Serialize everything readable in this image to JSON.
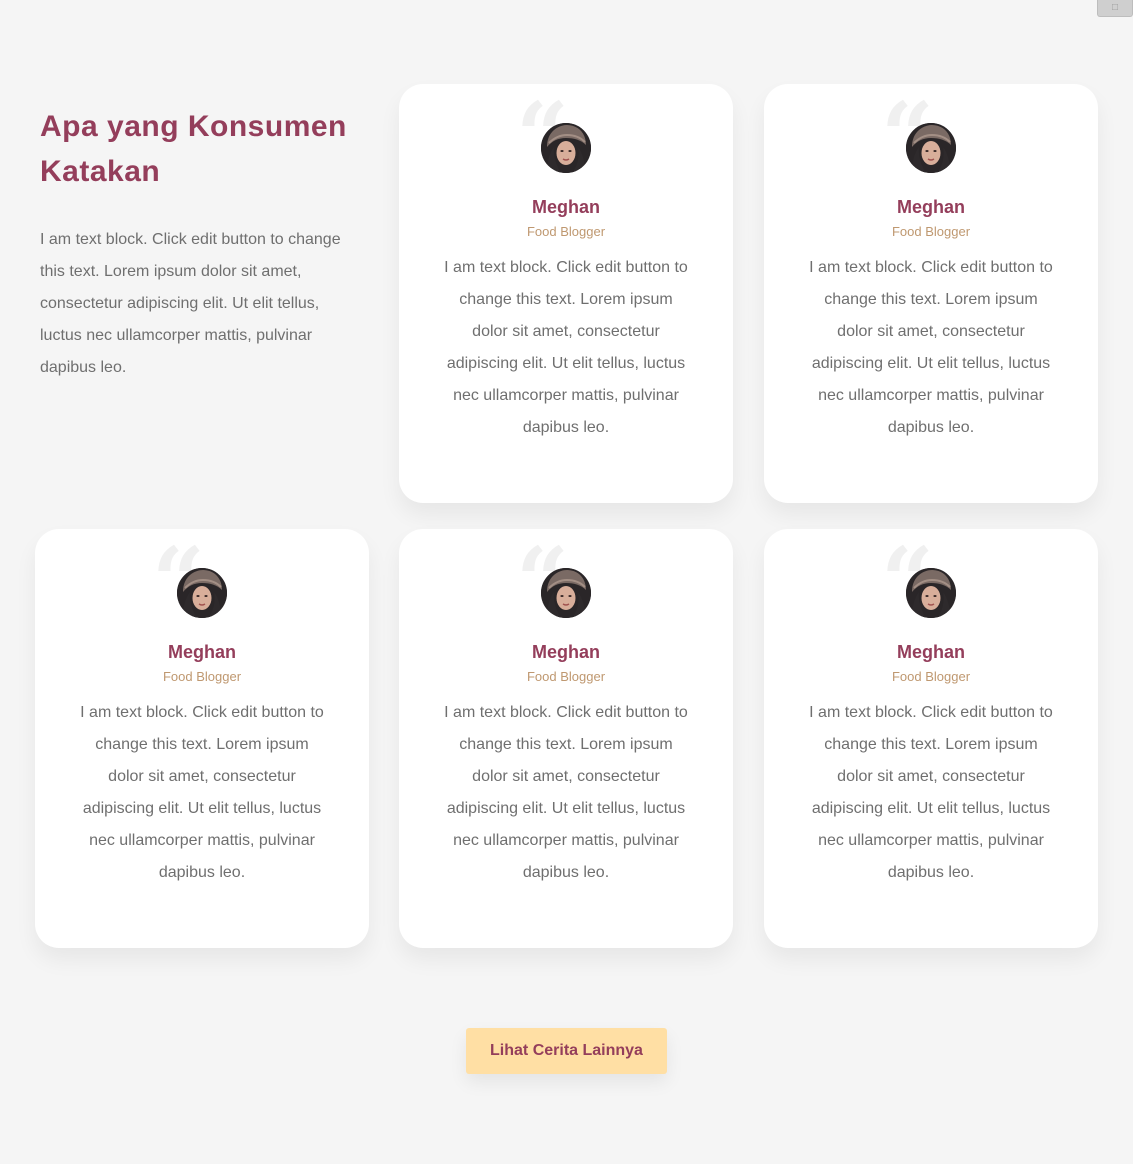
{
  "corner_icon": "image-icon",
  "colors": {
    "background": "#f5f5f5",
    "heading": "#943e5b",
    "body_text": "#6f6f6f",
    "role_text": "#bf9870",
    "button_bg": "#ffdfa4"
  },
  "intro": {
    "title": "Apa yang Konsumen Katakan",
    "text": "I am text block. Click edit button to change this text. Lorem ipsum dolor sit amet, consectetur adipiscing elit. Ut elit tellus, luctus nec ullamcorper mattis, pulvinar dapibus leo."
  },
  "testimonials": [
    {
      "quote_icon": "quote-icon",
      "avatar_icon": "avatar-photo",
      "name": "Meghan",
      "role": "Food Blogger",
      "text": "I am text block. Click edit button to change this text. Lorem ipsum dolor sit amet, consectetur adipiscing elit. Ut elit tellus, luctus nec ullamcorper mattis, pulvinar dapibus leo."
    },
    {
      "quote_icon": "quote-icon",
      "avatar_icon": "avatar-photo",
      "name": "Meghan",
      "role": "Food Blogger",
      "text": "I am text block. Click edit button to change this text. Lorem ipsum dolor sit amet, consectetur adipiscing elit. Ut elit tellus, luctus nec ullamcorper mattis, pulvinar dapibus leo."
    },
    {
      "quote_icon": "quote-icon",
      "avatar_icon": "avatar-photo",
      "name": "Meghan",
      "role": "Food Blogger",
      "text": "I am text block. Click edit button to change this text. Lorem ipsum dolor sit amet, consectetur adipiscing elit. Ut elit tellus, luctus nec ullamcorper mattis, pulvinar dapibus leo."
    },
    {
      "quote_icon": "quote-icon",
      "avatar_icon": "avatar-photo",
      "name": "Meghan",
      "role": "Food Blogger",
      "text": "I am text block. Click edit button to change this text. Lorem ipsum dolor sit amet, consectetur adipiscing elit. Ut elit tellus, luctus nec ullamcorper mattis, pulvinar dapibus leo."
    },
    {
      "quote_icon": "quote-icon",
      "avatar_icon": "avatar-photo",
      "name": "Meghan",
      "role": "Food Blogger",
      "text": "I am text block. Click edit button to change this text. Lorem ipsum dolor sit amet, consectetur adipiscing elit. Ut elit tellus, luctus nec ullamcorper mattis, pulvinar dapibus leo."
    }
  ],
  "cta": {
    "label": "Lihat Cerita Lainnya"
  }
}
